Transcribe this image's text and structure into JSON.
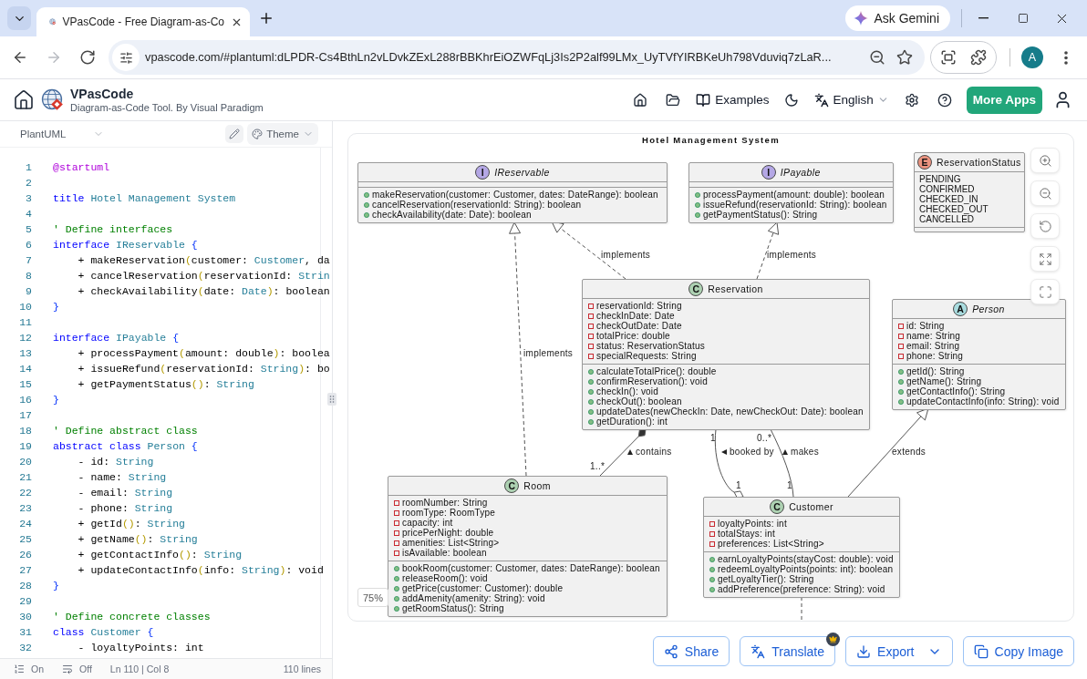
{
  "browser": {
    "tabs": [
      {
        "title": "VPasCode - Free Diagram-as-Co",
        "selected": true
      }
    ],
    "gemini_button": "Ask Gemini",
    "nav_buttons": [
      {
        "kind": "back",
        "disabled": false
      },
      {
        "kind": "forward",
        "disabled": true
      },
      {
        "kind": "reload",
        "disabled": false
      }
    ],
    "address": "vpascode.com/#plantuml:dLPDR-Cs4BthLn2vLDvkZExL288rBBKhrEiOZWFqLj3Is2P2alf99LMx_UyTVfYIRBKeUh798Vduviq7zLaR...",
    "profile_initial": "A"
  },
  "app": {
    "name": "VPasCode",
    "tagline": "Diagram-as-Code Tool. By Visual Paradigm",
    "examples": "Examples",
    "language": "English",
    "more_apps": "More Apps"
  },
  "editor": {
    "language": "PlantUML",
    "theme": "Theme",
    "lines": [
      {
        "number": "1",
        "tokens": [
          {
            "kind": "meta",
            "text": "@startuml"
          }
        ]
      },
      {
        "number": "2"
      },
      {
        "number": "3",
        "tokens": [
          {
            "kind": "keyword",
            "text": "title"
          },
          {
            "kind": "type",
            "text": " Hotel Management System"
          }
        ]
      },
      {
        "number": "4"
      },
      {
        "number": "5",
        "tokens": [
          {
            "kind": "comment",
            "text": "' Define interfaces"
          }
        ]
      },
      {
        "number": "6",
        "tokens": [
          {
            "kind": "keyword",
            "text": "interface"
          },
          {
            "kind": "type",
            "text": " IReservable"
          },
          {
            "kind": "brace",
            "text": " {"
          }
        ]
      },
      {
        "number": "7",
        "tokens": [
          {
            "kind": "text",
            "text": "    + makeReservation"
          },
          {
            "kind": "paren",
            "text": "("
          },
          {
            "kind": "text",
            "text": "customer: "
          },
          {
            "kind": "type",
            "text": "Customer"
          },
          {
            "kind": "text",
            "text": ", da"
          }
        ]
      },
      {
        "number": "8",
        "tokens": [
          {
            "kind": "text",
            "text": "    + cancelReservation"
          },
          {
            "kind": "paren",
            "text": "("
          },
          {
            "kind": "text",
            "text": "reservationId: "
          },
          {
            "kind": "type",
            "text": "Strin"
          }
        ]
      },
      {
        "number": "9",
        "tokens": [
          {
            "kind": "text",
            "text": "    + checkAvailability"
          },
          {
            "kind": "paren",
            "text": "("
          },
          {
            "kind": "text",
            "text": "date: "
          },
          {
            "kind": "type",
            "text": "Date"
          },
          {
            "kind": "paren",
            "text": ")"
          },
          {
            "kind": "text",
            "text": ": boolean"
          }
        ]
      },
      {
        "number": "10",
        "tokens": [
          {
            "kind": "brace",
            "text": "}"
          }
        ]
      },
      {
        "number": "11"
      },
      {
        "number": "12",
        "tokens": [
          {
            "kind": "keyword",
            "text": "interface"
          },
          {
            "kind": "type",
            "text": " IPayable"
          },
          {
            "kind": "brace",
            "text": " {"
          }
        ]
      },
      {
        "number": "13",
        "tokens": [
          {
            "kind": "text",
            "text": "    + processPayment"
          },
          {
            "kind": "paren",
            "text": "("
          },
          {
            "kind": "text",
            "text": "amount: double"
          },
          {
            "kind": "paren",
            "text": ")"
          },
          {
            "kind": "text",
            "text": ": boolea"
          }
        ]
      },
      {
        "number": "14",
        "tokens": [
          {
            "kind": "text",
            "text": "    + issueRefund"
          },
          {
            "kind": "paren",
            "text": "("
          },
          {
            "kind": "text",
            "text": "reservationId: "
          },
          {
            "kind": "type",
            "text": "String"
          },
          {
            "kind": "paren",
            "text": ")"
          },
          {
            "kind": "text",
            "text": ": bo"
          }
        ]
      },
      {
        "number": "15",
        "tokens": [
          {
            "kind": "text",
            "text": "    + getPaymentStatus"
          },
          {
            "kind": "paren",
            "text": "()"
          },
          {
            "kind": "text",
            "text": ": "
          },
          {
            "kind": "type",
            "text": "String"
          }
        ]
      },
      {
        "number": "16",
        "tokens": [
          {
            "kind": "brace",
            "text": "}"
          }
        ]
      },
      {
        "number": "17"
      },
      {
        "number": "18",
        "tokens": [
          {
            "kind": "comment",
            "text": "' Define abstract class"
          }
        ]
      },
      {
        "number": "19",
        "tokens": [
          {
            "kind": "keyword",
            "text": "abstract class"
          },
          {
            "kind": "type",
            "text": " Person"
          },
          {
            "kind": "brace",
            "text": " {"
          }
        ]
      },
      {
        "number": "20",
        "tokens": [
          {
            "kind": "text",
            "text": "    - id: "
          },
          {
            "kind": "type",
            "text": "String"
          }
        ]
      },
      {
        "number": "21",
        "tokens": [
          {
            "kind": "text",
            "text": "    - name: "
          },
          {
            "kind": "type",
            "text": "String"
          }
        ]
      },
      {
        "number": "22",
        "tokens": [
          {
            "kind": "text",
            "text": "    - email: "
          },
          {
            "kind": "type",
            "text": "String"
          }
        ]
      },
      {
        "number": "23",
        "tokens": [
          {
            "kind": "text",
            "text": "    - phone: "
          },
          {
            "kind": "type",
            "text": "String"
          }
        ]
      },
      {
        "number": "24",
        "tokens": [
          {
            "kind": "text",
            "text": "    + getId"
          },
          {
            "kind": "paren",
            "text": "()"
          },
          {
            "kind": "text",
            "text": ": "
          },
          {
            "kind": "type",
            "text": "String"
          }
        ]
      },
      {
        "number": "25",
        "tokens": [
          {
            "kind": "text",
            "text": "    + getName"
          },
          {
            "kind": "paren",
            "text": "()"
          },
          {
            "kind": "text",
            "text": ": "
          },
          {
            "kind": "type",
            "text": "String"
          }
        ]
      },
      {
        "number": "26",
        "tokens": [
          {
            "kind": "text",
            "text": "    + getContactInfo"
          },
          {
            "kind": "paren",
            "text": "()"
          },
          {
            "kind": "text",
            "text": ": "
          },
          {
            "kind": "type",
            "text": "String"
          }
        ]
      },
      {
        "number": "27",
        "tokens": [
          {
            "kind": "text",
            "text": "    + updateContactInfo"
          },
          {
            "kind": "paren",
            "text": "("
          },
          {
            "kind": "text",
            "text": "info: "
          },
          {
            "kind": "type",
            "text": "String"
          },
          {
            "kind": "paren",
            "text": ")"
          },
          {
            "kind": "text",
            "text": ": void"
          }
        ]
      },
      {
        "number": "28",
        "tokens": [
          {
            "kind": "brace",
            "text": "}"
          }
        ]
      },
      {
        "number": "29"
      },
      {
        "number": "30",
        "tokens": [
          {
            "kind": "comment",
            "text": "' Define concrete classes"
          }
        ]
      },
      {
        "number": "31",
        "tokens": [
          {
            "kind": "keyword",
            "text": "class"
          },
          {
            "kind": "type",
            "text": " Customer"
          },
          {
            "kind": "brace",
            "text": " {"
          }
        ]
      },
      {
        "number": "32",
        "tokens": [
          {
            "kind": "text",
            "text": "    - loyaltyPoints: int"
          }
        ]
      }
    ],
    "status": {
      "line_numbers": "On",
      "word_wrap": "Off",
      "cursor": "Ln 110 | Col 8",
      "line_count": "110 lines"
    }
  },
  "diagram": {
    "title": "Hotel Management System",
    "classes": [
      {
        "kind": "interface",
        "badge": "I",
        "name": "IReservable",
        "methods": [
          "makeReservation(customer: Customer, dates: DateRange): boolean",
          "cancelReservation(reservationId: String): boolean",
          "checkAvailability(date: Date): boolean"
        ]
      },
      {
        "kind": "interface",
        "badge": "I",
        "name": "IPayable",
        "methods": [
          "processPayment(amount: double): boolean",
          "issueRefund(reservationId: String): boolean",
          "getPaymentStatus(): String"
        ]
      },
      {
        "kind": "enum",
        "badge": "E",
        "name": "ReservationStatus",
        "values": [
          "PENDING",
          "CONFIRMED",
          "CHECKED_IN",
          "CHECKED_OUT",
          "CANCELLED"
        ]
      },
      {
        "kind": "class",
        "badge": "C",
        "name": "Reservation",
        "fields": [
          "reservationId: String",
          "checkInDate: Date",
          "checkOutDate: Date",
          "totalPrice: double",
          "status: ReservationStatus",
          "specialRequests: String"
        ],
        "methods": [
          "calculateTotalPrice(): double",
          "confirmReservation(): void",
          "checkIn(): void",
          "checkOut(): boolean",
          "updateDates(newCheckIn: Date, newCheckOut: Date): boolean",
          "getDuration(): int"
        ]
      },
      {
        "kind": "abstract",
        "badge": "A",
        "name": "Person",
        "fields": [
          "id: String",
          "name: String",
          "email: String",
          "phone: String"
        ],
        "methods": [
          "getId(): String",
          "getName(): String",
          "getContactInfo(): String",
          "updateContactInfo(info: String): void"
        ]
      },
      {
        "kind": "class",
        "badge": "C",
        "name": "Room",
        "fields": [
          "roomNumber: String",
          "roomType: RoomType",
          "capacity: int",
          "pricePerNight: double",
          "amenities: List<String>",
          "isAvailable: boolean"
        ],
        "methods": [
          "bookRoom(customer: Customer, dates: DateRange): boolean",
          "releaseRoom(): void",
          "getPrice(customer: Customer): double",
          "addAmenity(amenity: String): void",
          "getRoomStatus(): String"
        ]
      },
      {
        "kind": "class",
        "badge": "C",
        "name": "Customer",
        "fields": [
          "loyaltyPoints: int",
          "totalStays: int",
          "preferences: List<String>"
        ],
        "methods": [
          "earnLoyaltyPoints(stayCost: double): void",
          "redeemLoyaltyPoints(points: int): boolean",
          "getLoyaltyTier(): String",
          "addPreference(preference: String): void"
        ]
      }
    ],
    "relations": [
      {
        "kind": "realization",
        "label": "implements"
      },
      {
        "kind": "realization",
        "label": "implements"
      },
      {
        "kind": "realization",
        "label": "implements"
      },
      {
        "kind": "composition",
        "label": "contains",
        "source_multiplicity": "1..*"
      },
      {
        "kind": "aggregation",
        "label": "booked by",
        "source_multiplicity": "1",
        "target_multiplicity": "1"
      },
      {
        "kind": "association",
        "label": "makes",
        "source_multiplicity": "0..*",
        "target_multiplicity": "1"
      },
      {
        "kind": "generalization",
        "label": "extends"
      },
      {
        "kind": "dependency"
      }
    ],
    "zoom": "75%"
  },
  "actions": [
    {
      "kind": "share",
      "label": "Share"
    },
    {
      "kind": "translate",
      "label": "Translate",
      "premium": true
    },
    {
      "kind": "export",
      "label": "Export",
      "menu": true
    },
    {
      "kind": "copy",
      "label": "Copy Image"
    }
  ]
}
